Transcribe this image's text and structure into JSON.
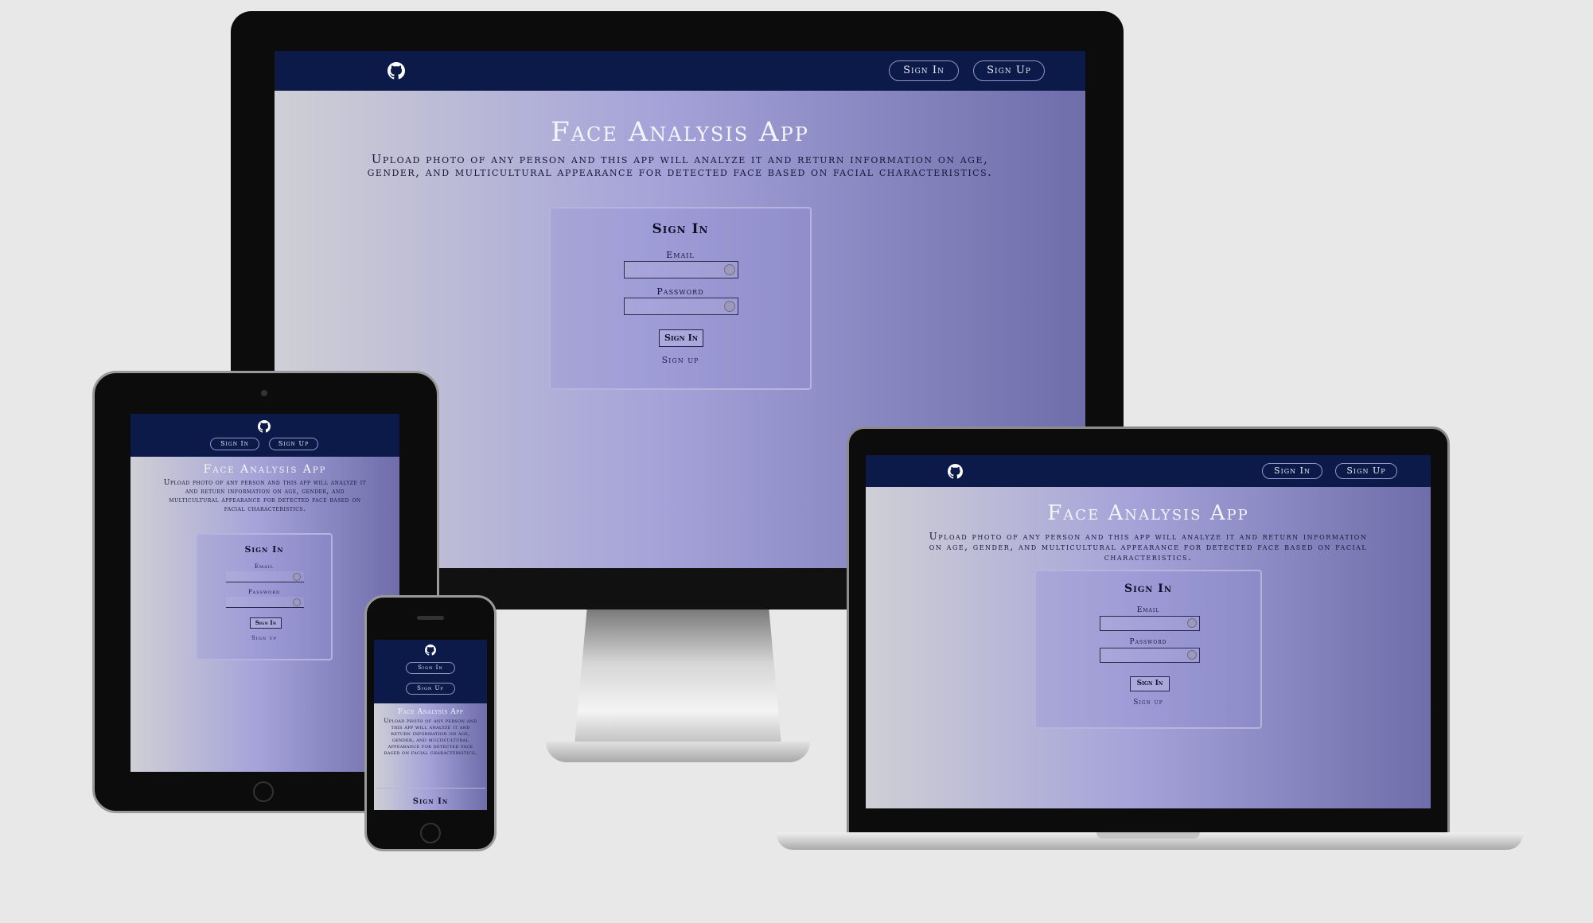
{
  "app": {
    "title": "Face Analysis App",
    "description": "Upload photo of any person and this app will analyze it and return information on age, gender, and multicultural appearance for detected face based on facial characteristics."
  },
  "nav": {
    "github_icon": "github-icon",
    "sign_in": "Sign In",
    "sign_up": "Sign Up"
  },
  "form": {
    "title": "Sign In",
    "email_label": "Email",
    "password_label": "Password",
    "submit": "Sign In",
    "signup_link": "Sign up"
  },
  "colors": {
    "navbar": "#0b1a48",
    "gradient_start": "#cfcfd6",
    "gradient_mid": "#a4a2d8",
    "gradient_end": "#6f6daa",
    "background": "#e8e8e8"
  }
}
